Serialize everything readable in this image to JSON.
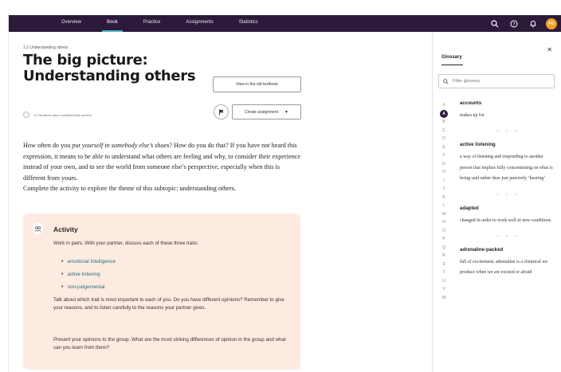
{
  "nav": {
    "tabs": [
      {
        "label": "Overview"
      },
      {
        "label": "Book"
      },
      {
        "label": "Practice"
      },
      {
        "label": "Assignments"
      },
      {
        "label": "Statistics"
      }
    ],
    "active_tab": "Book",
    "avatar_initials": "PG",
    "icons": [
      "search-icon",
      "help-icon",
      "notification-bell-icon"
    ]
  },
  "section": {
    "breadcrumb": "1.2 Understanding others",
    "title": "The big picture: Understanding others",
    "progress_text": "1/1 Students have completed this section",
    "old_textbook_button": "View in the old textbook",
    "create_assignment_button": "Create assignment"
  },
  "body": {
    "p1_before": "How often do you ",
    "p1_em": "put yourself in somebody else’s shoes",
    "p1_after": "? How do you do that? If you have not heard this expression, it means to be able to understand what others are feeling and why, to consider their experience instead of your own, and to see the world from someone else’s perspective, especially when this is different from yours.",
    "p2": "Complete the activity to explore the theme of this subtopic: understanding others."
  },
  "activity": {
    "title": "Activity",
    "intro": "Work in pairs. With your partner, discuss each of these three traits:",
    "traits": [
      "emotional intelligence",
      "active listening",
      "non-judgemental."
    ],
    "p1": "Talk about which trait is most important to each of you. Do you have different opinions? Remember to give your reasons, and to listen carefully to the reasons your partner gives.",
    "p2": "Present your opinions to the group. What are the most striking differences of opinion in the group and what can you learn from them?"
  },
  "glossary": {
    "title": "Glossary",
    "search_placeholder": "Filter glossary",
    "letters": [
      "#",
      "A",
      "B",
      "C",
      "D",
      "E",
      "F",
      "G",
      "H",
      "I",
      "J",
      "K",
      "L",
      "M",
      "N",
      "O",
      "P",
      "Q",
      "R",
      "S",
      "T",
      "U",
      "V",
      "W"
    ],
    "active_letter": "A",
    "entries": [
      {
        "term": "accounts",
        "definition": "makes up for"
      },
      {
        "term": "active listening",
        "definition": "a way of listening and responding to another person that implies fully concentrating on what is being said rather than just passively ‘hearing’"
      },
      {
        "term": "adapted",
        "definition": "changed in order to work well in new conditions"
      },
      {
        "term": "adrenaline-packed",
        "definition": "full of excitement; adrenaline is a chemical we produce when we are excited or afraid"
      }
    ]
  },
  "colors": {
    "nav_bg": "#2b1a3a",
    "active_tab_underline": "#4db3c8",
    "avatar": "#f3a01f",
    "activity_bg": "#fdebe1",
    "link": "#2a6f7f"
  }
}
